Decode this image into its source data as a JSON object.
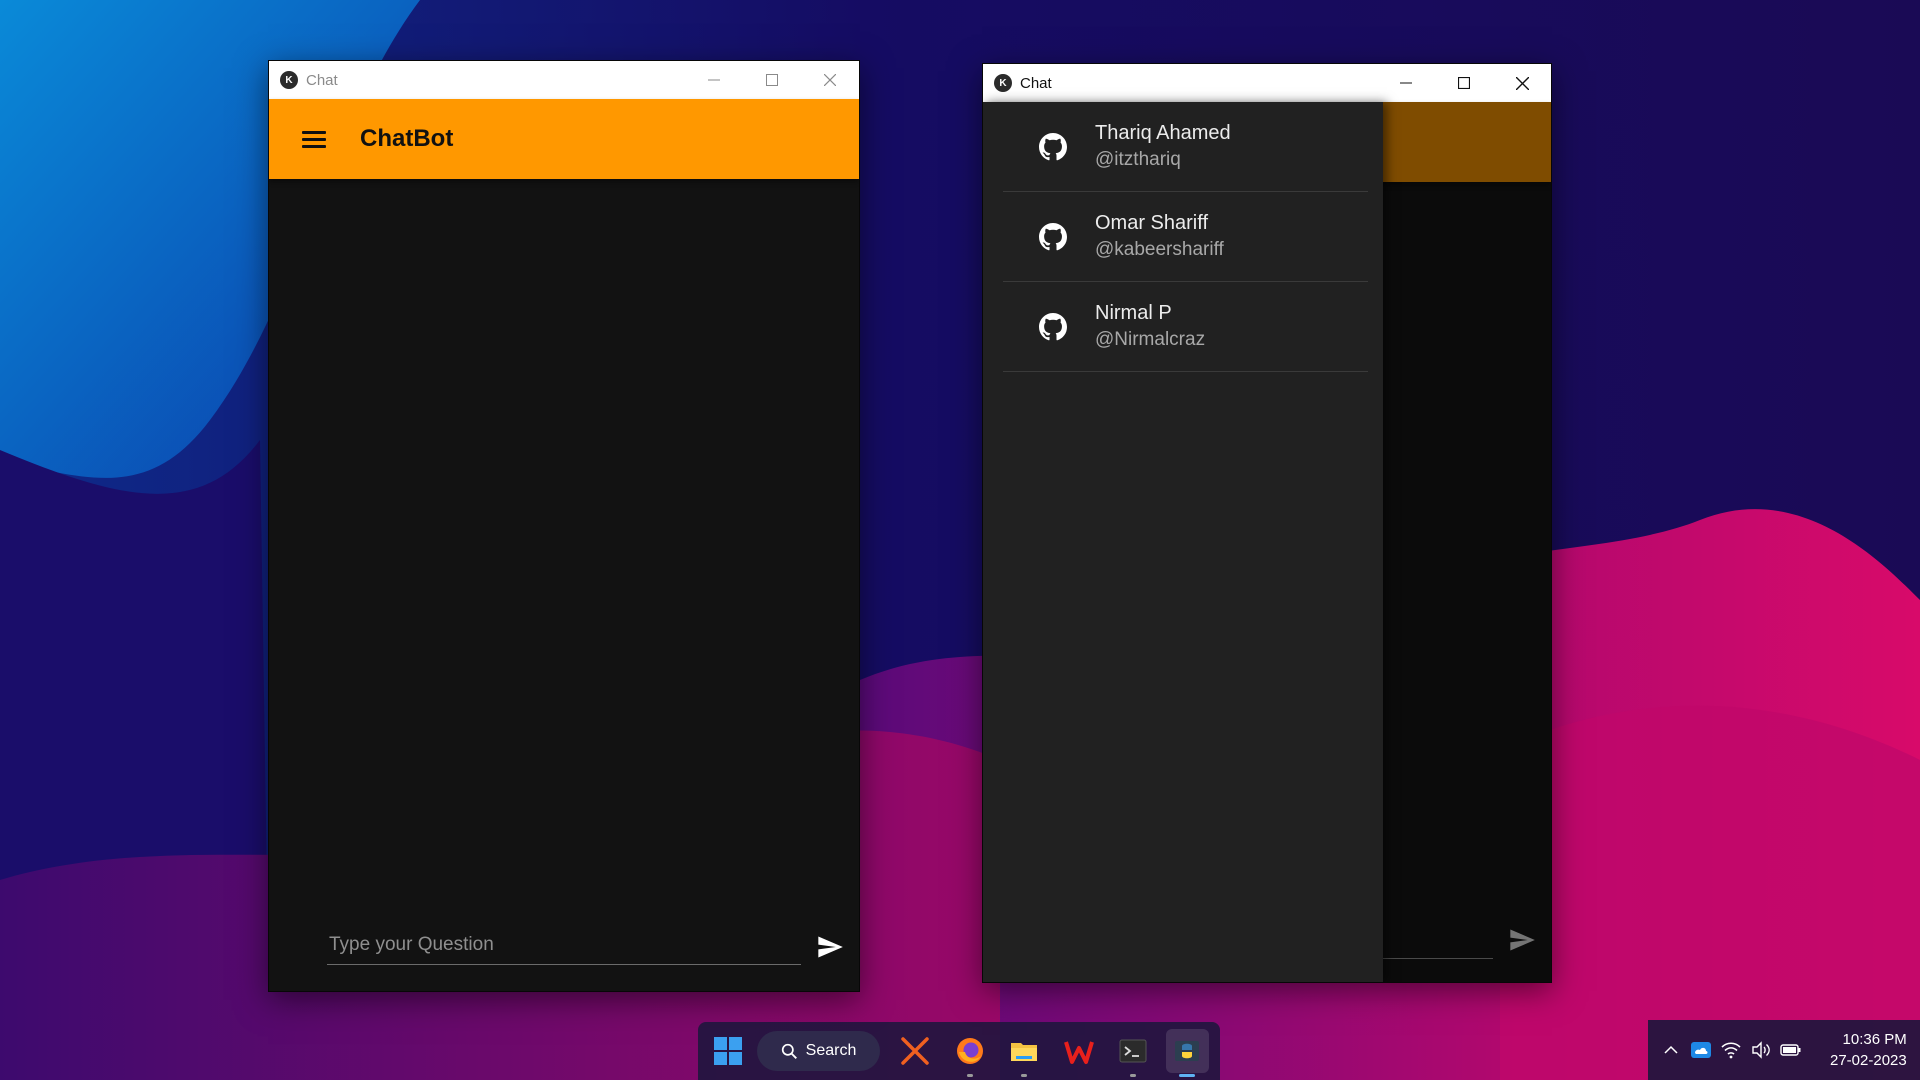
{
  "desktop": {
    "accent": "#ff9800"
  },
  "left_window": {
    "title": "Chat",
    "appbar_title": "ChatBot",
    "input_placeholder": "Type your Question",
    "input_value": ""
  },
  "right_window": {
    "title": "Chat",
    "drawer": {
      "items": [
        {
          "name": "Thariq Ahamed",
          "handle": "@itzthariq",
          "icon": "github-icon"
        },
        {
          "name": "Omar Shariff",
          "handle": "@kabeershariff",
          "icon": "github-icon"
        },
        {
          "name": "Nirmal P",
          "handle": "@Nirmalcraz",
          "icon": "github-icon"
        }
      ]
    }
  },
  "taskbar": {
    "search_label": "Search",
    "apps": [
      "windows-start-icon",
      "x-app-icon",
      "firefox-icon",
      "file-explorer-icon",
      "wps-office-icon",
      "terminal-icon",
      "python-icon"
    ]
  },
  "tray": {
    "time": "10:36 PM",
    "date": "27-02-2023",
    "icons": [
      "chevron-up-icon",
      "onedrive-icon",
      "wifi-icon",
      "volume-icon",
      "battery-icon"
    ]
  }
}
